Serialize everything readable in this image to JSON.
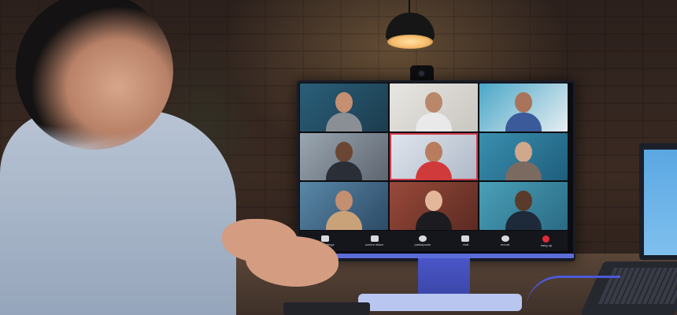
{
  "meeting": {
    "toolbar": [
      {
        "label": "mute settings",
        "icon": "microphone-icon"
      },
      {
        "label": "screen share",
        "icon": "screen-share-icon"
      },
      {
        "label": "participants",
        "icon": "participants-icon"
      },
      {
        "label": "chat",
        "icon": "chat-icon"
      },
      {
        "label": "record",
        "icon": "record-icon"
      },
      {
        "label": "hang up",
        "icon": "hang-up-icon",
        "color": "#e02a38"
      }
    ],
    "active_speaker_color": "#d4394a",
    "participant_count": 9
  },
  "colors": {
    "monitor_accent": "#5c6cd8",
    "laptop_screen": "#5ba7e3",
    "lamp_glow": "#ffe2a6"
  }
}
